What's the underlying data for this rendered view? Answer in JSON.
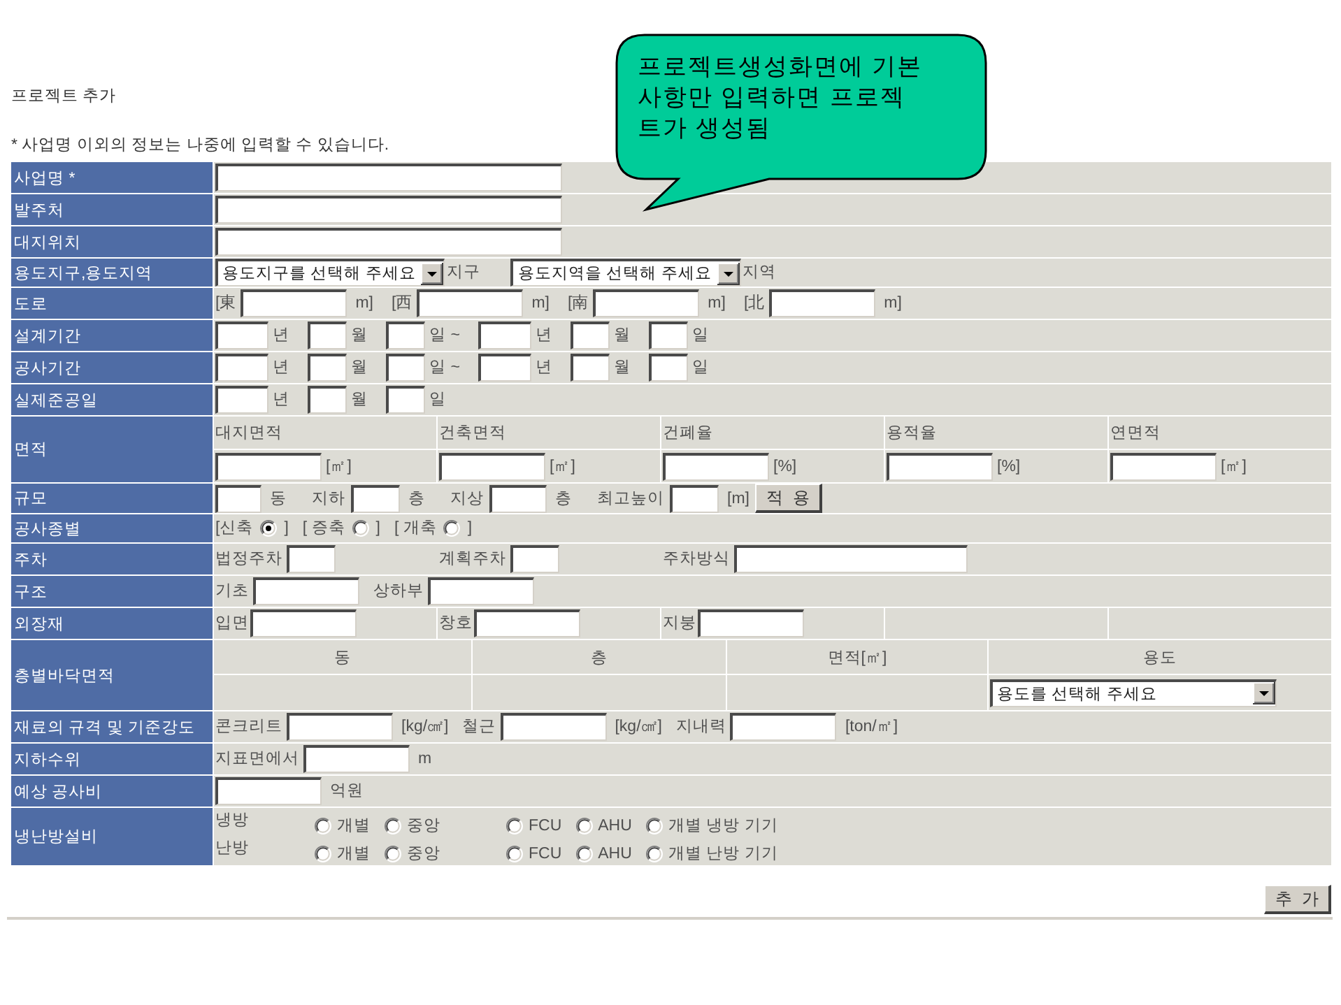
{
  "page": {
    "title": "프로젝트 추가",
    "note": "* 사업명 이외의 정보는 나중에 입력할 수 있습니다."
  },
  "callout": {
    "lines": [
      "프로젝트생성화면에 기본",
      "사항만 입력하면 프로젝",
      "트가 생성됨"
    ]
  },
  "form": {
    "rows": [
      {
        "label": "사업명 *",
        "kind": "text"
      },
      {
        "label": "발주처",
        "kind": "text"
      },
      {
        "label": "대지위치",
        "kind": "text"
      },
      {
        "label": "용도지구,용도지역",
        "kind": "select",
        "selects": [
          {
            "value": "용도지구를 선택해 주세요",
            "unit": "지구"
          },
          {
            "value": "용도지역을 선택해 주세요",
            "unit": "지역"
          }
        ]
      },
      {
        "label": "도로",
        "kind": "road",
        "sides": [
          {
            "prefix": "[東",
            "unit": "m]"
          },
          {
            "prefix": "[西",
            "unit": "m]"
          },
          {
            "prefix": "[南",
            "unit": "m]"
          },
          {
            "prefix": "[北",
            "unit": "m]"
          }
        ]
      },
      {
        "label": "설계기간",
        "kind": "period",
        "units": [
          "년",
          "월",
          "일 ~",
          "년",
          "월",
          "일"
        ]
      },
      {
        "label": "공사기간",
        "kind": "period",
        "units": [
          "년",
          "월",
          "일 ~",
          "년",
          "월",
          "일"
        ]
      },
      {
        "label": "실제준공일",
        "kind": "period",
        "units": [
          "년",
          "월",
          "일"
        ]
      },
      {
        "label": "면적",
        "kind": "area",
        "columns": [
          {
            "heading": "대지면적",
            "unit": "[㎡]"
          },
          {
            "heading": "건축면적",
            "unit": "[㎡]"
          },
          {
            "heading": "건폐율",
            "unit": "[%]"
          },
          {
            "heading": "용적율",
            "unit": "[%]"
          },
          {
            "heading": "연면적",
            "unit": "[㎡]"
          }
        ]
      },
      {
        "label": "규모",
        "kind": "scale",
        "items": [
          {
            "unit": "동"
          },
          {
            "label": "지하",
            "unit": "층"
          },
          {
            "label": "지상",
            "unit": "층"
          },
          {
            "label": "최고높이",
            "unit": "[m]"
          }
        ],
        "button": "적 용"
      },
      {
        "label": "공사종별",
        "kind": "choice",
        "options": [
          {
            "before": "[신축",
            "after": "]",
            "selected": true
          },
          {
            "before": "[ 증축",
            "after": "]",
            "selected": false
          },
          {
            "before": "[ 개축",
            "after": "]",
            "selected": false
          }
        ]
      },
      {
        "label": "주차",
        "kind": "grid",
        "items": [
          {
            "label": "법정주차"
          },
          {
            "label": "계획주차"
          },
          {
            "label": "주차방식"
          }
        ]
      },
      {
        "label": "구조",
        "kind": "inline",
        "items": [
          {
            "label": "기초"
          },
          {
            "label": "상하부"
          }
        ]
      },
      {
        "label": "외장재",
        "kind": "cells",
        "items": [
          {
            "label": "입면"
          },
          {
            "label": "창호"
          },
          {
            "label": "지붕"
          }
        ]
      },
      {
        "label": "층별바닥면적",
        "kind": "floors",
        "columns": [
          "동",
          "층",
          "면적[㎡]",
          "용도"
        ],
        "select": "용도를 선택해 주세요"
      },
      {
        "label": "재료의 규격 및 기준강도",
        "kind": "inline",
        "items": [
          {
            "label": "콘크리트",
            "unit": "[kg/㎠]"
          },
          {
            "label": "철근",
            "unit": "[kg/㎠]"
          },
          {
            "label": "지내력",
            "unit": "[ton/㎡]"
          }
        ]
      },
      {
        "label": "지하수위",
        "kind": "inline",
        "items": [
          {
            "label": "지표면에서",
            "unit": "m"
          }
        ]
      },
      {
        "label": "예상 공사비",
        "kind": "inline",
        "items": [
          {
            "unit": "억원"
          }
        ]
      },
      {
        "label": "냉난방설비",
        "kind": "hvac",
        "systems": [
          {
            "label": "냉방",
            "groups": [
              {
                "options": [
                  {
                    "label": "개별",
                    "selected": false
                  },
                  {
                    "label": "중앙",
                    "selected": false
                  }
                ]
              },
              {
                "options": [
                  {
                    "label": "FCU",
                    "selected": false
                  },
                  {
                    "label": "AHU",
                    "selected": false
                  },
                  {
                    "label": "개별 냉방 기기",
                    "selected": false
                  }
                ]
              }
            ]
          },
          {
            "label": "난방",
            "groups": [
              {
                "options": [
                  {
                    "label": "개별",
                    "selected": false
                  },
                  {
                    "label": "중앙",
                    "selected": false
                  }
                ]
              },
              {
                "options": [
                  {
                    "label": "FCU",
                    "selected": false
                  },
                  {
                    "label": "AHU",
                    "selected": false
                  },
                  {
                    "label": "개별 난방 기기",
                    "selected": false
                  }
                ]
              }
            ]
          }
        ]
      }
    ]
  },
  "submit_button": {
    "label": "추 가"
  }
}
